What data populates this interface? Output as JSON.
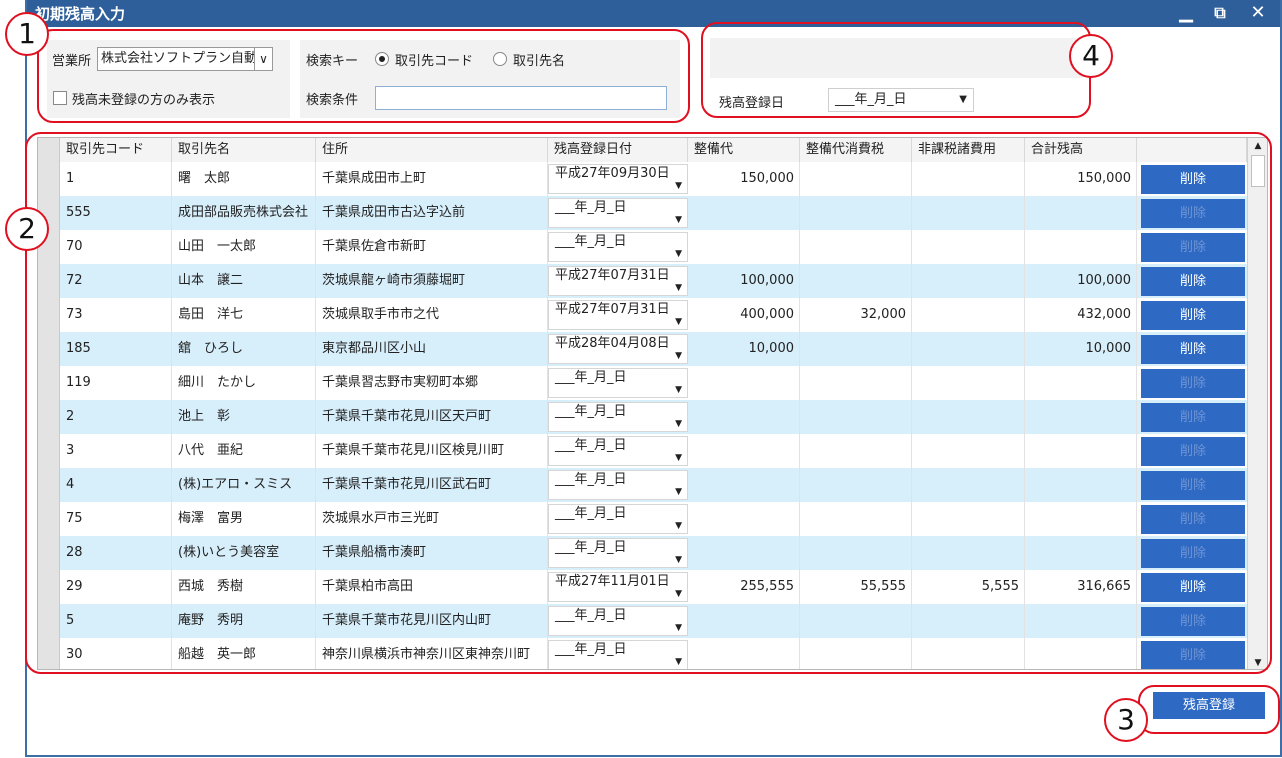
{
  "window": {
    "title": "初期残高入力",
    "controls": {
      "minimize": "▁",
      "restore": "⧉",
      "close": "✕"
    }
  },
  "filters": {
    "office_label": "営業所",
    "office_value": "株式会社ソフトプラン自動車",
    "unregistered_only_label": "残高未登録の方のみ表示",
    "unregistered_only_checked": false,
    "search_key_label": "検索キー",
    "search_key_options": [
      "取引先コード",
      "取引先名"
    ],
    "search_key_selected": "取引先コード",
    "search_cond_label": "検索条件",
    "search_cond_value": ""
  },
  "registration": {
    "date_label": "残高登録日",
    "date_value": "___年_月_日"
  },
  "grid": {
    "columns": [
      "取引先コード",
      "取引先名",
      "住所",
      "残高登録日付",
      "整備代",
      "整備代消費税",
      "非課税諸費用",
      "合計残高",
      ""
    ],
    "delete_label": "削除",
    "rows": [
      {
        "code": "1",
        "name": "曙　太郎",
        "address": "千葉県成田市上町",
        "date": "平成27年09月30日",
        "maint": "150,000",
        "tax": "",
        "nontax": "",
        "total": "150,000",
        "active": true
      },
      {
        "code": "555",
        "name": "成田部品販売株式会社",
        "address": "千葉県成田市古込字込前",
        "date": "___年_月_日",
        "maint": "",
        "tax": "",
        "nontax": "",
        "total": "",
        "active": false
      },
      {
        "code": "70",
        "name": "山田　一太郎",
        "address": "千葉県佐倉市新町",
        "date": "___年_月_日",
        "maint": "",
        "tax": "",
        "nontax": "",
        "total": "",
        "active": false
      },
      {
        "code": "72",
        "name": "山本　譲二",
        "address": "茨城県龍ヶ崎市須藤堀町",
        "date": "平成27年07月31日",
        "maint": "100,000",
        "tax": "",
        "nontax": "",
        "total": "100,000",
        "active": true
      },
      {
        "code": "73",
        "name": "島田　洋七",
        "address": "茨城県取手市市之代",
        "date": "平成27年07月31日",
        "maint": "400,000",
        "tax": "32,000",
        "nontax": "",
        "total": "432,000",
        "active": true
      },
      {
        "code": "185",
        "name": "舘　ひろし",
        "address": "東京都品川区小山",
        "date": "平成28年04月08日",
        "maint": "10,000",
        "tax": "",
        "nontax": "",
        "total": "10,000",
        "active": true
      },
      {
        "code": "119",
        "name": "細川　たかし",
        "address": "千葉県習志野市実籾町本郷",
        "date": "___年_月_日",
        "maint": "",
        "tax": "",
        "nontax": "",
        "total": "",
        "active": false
      },
      {
        "code": "2",
        "name": "池上　彰",
        "address": "千葉県千葉市花見川区天戸町",
        "date": "___年_月_日",
        "maint": "",
        "tax": "",
        "nontax": "",
        "total": "",
        "active": false
      },
      {
        "code": "3",
        "name": "八代　亜紀",
        "address": "千葉県千葉市花見川区検見川町",
        "date": "___年_月_日",
        "maint": "",
        "tax": "",
        "nontax": "",
        "total": "",
        "active": false
      },
      {
        "code": "4",
        "name": "(株)エアロ・スミス",
        "address": "千葉県千葉市花見川区武石町",
        "date": "___年_月_日",
        "maint": "",
        "tax": "",
        "nontax": "",
        "total": "",
        "active": false
      },
      {
        "code": "75",
        "name": "梅澤　富男",
        "address": "茨城県水戸市三光町",
        "date": "___年_月_日",
        "maint": "",
        "tax": "",
        "nontax": "",
        "total": "",
        "active": false
      },
      {
        "code": "28",
        "name": "(株)いとう美容室",
        "address": "千葉県船橋市湊町",
        "date": "___年_月_日",
        "maint": "",
        "tax": "",
        "nontax": "",
        "total": "",
        "active": false
      },
      {
        "code": "29",
        "name": "西城　秀樹",
        "address": "千葉県柏市高田",
        "date": "平成27年11月01日",
        "maint": "255,555",
        "tax": "55,555",
        "nontax": "5,555",
        "total": "316,665",
        "active": true
      },
      {
        "code": "5",
        "name": "庵野　秀明",
        "address": "千葉県千葉市花見川区内山町",
        "date": "___年_月_日",
        "maint": "",
        "tax": "",
        "nontax": "",
        "total": "",
        "active": false
      },
      {
        "code": "30",
        "name": "船越　英一郎",
        "address": "神奈川県横浜市神奈川区東神奈川町",
        "date": "___年_月_日",
        "maint": "",
        "tax": "",
        "nontax": "",
        "total": "",
        "active": false
      }
    ]
  },
  "register_button": "残高登録",
  "callouts": [
    "1",
    "2",
    "3",
    "4"
  ],
  "colors": {
    "titlebar": "#2e5f9a",
    "button": "#2e6ac4",
    "alt_row": "#d7eefb",
    "callout": "#e01020"
  }
}
